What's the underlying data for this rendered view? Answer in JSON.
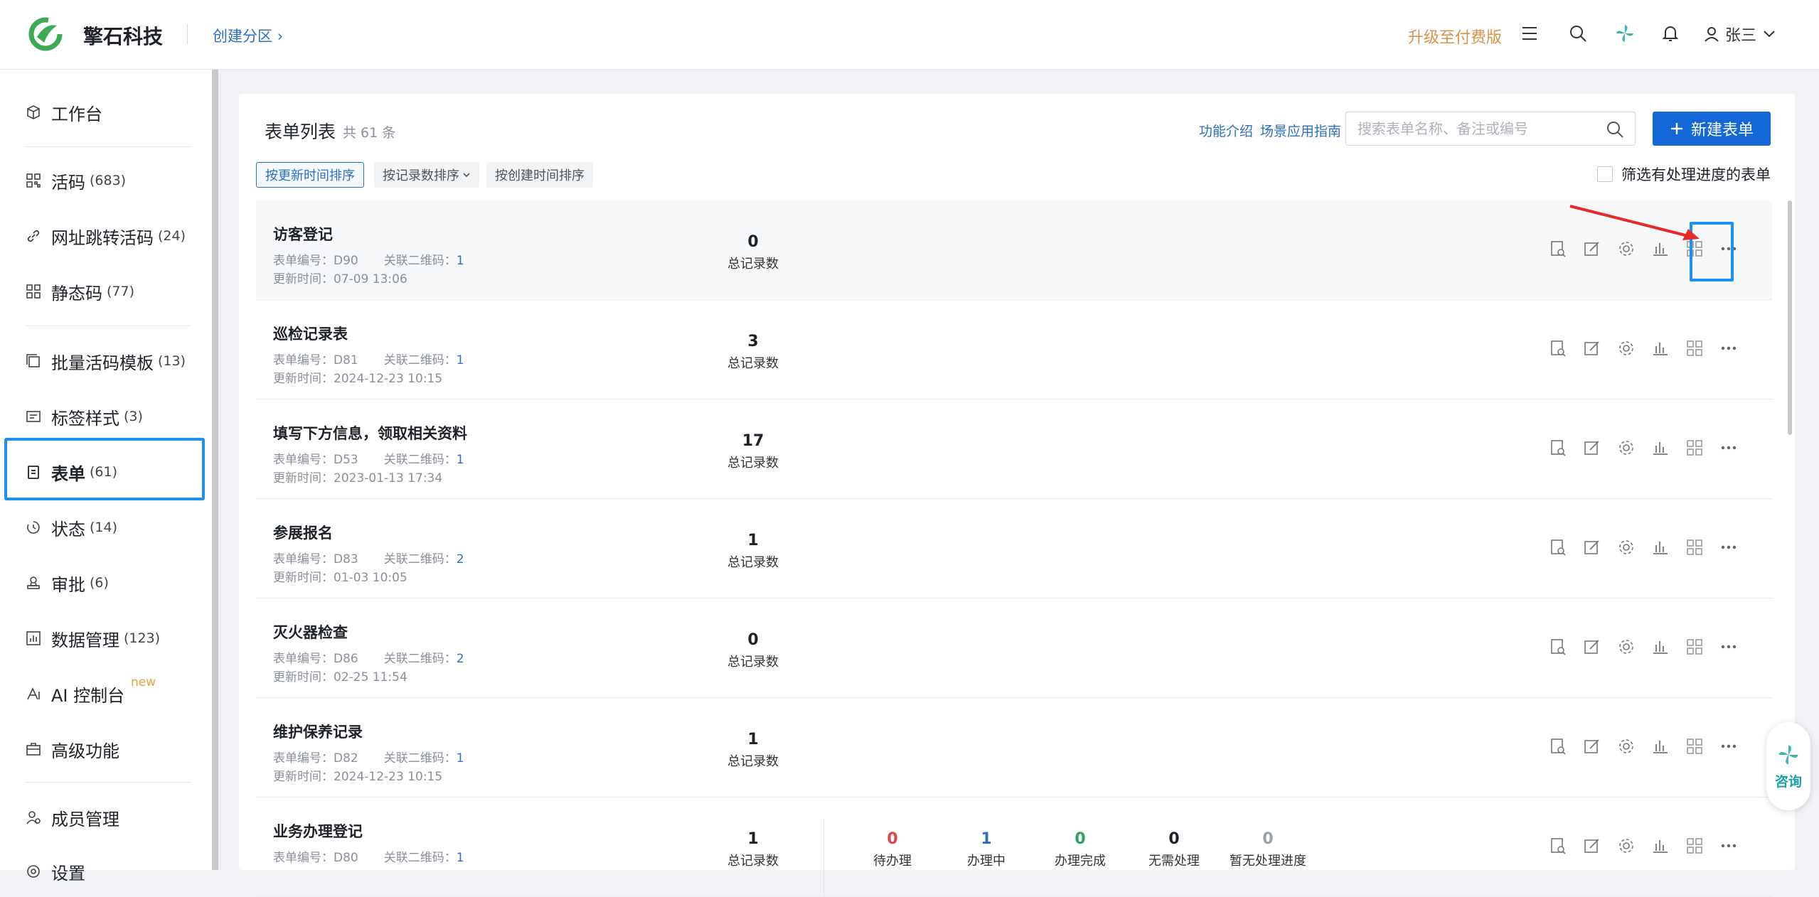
{
  "header": {
    "brand": "擎石科技",
    "breadcrumb": "创建分区",
    "upgrade": "升级至付费版",
    "user_name": "张三"
  },
  "sidebar": {
    "items": [
      {
        "label": "工作台",
        "count": "",
        "icon": "cube-icon"
      },
      {
        "label": "活码",
        "count": "(683)",
        "icon": "qrcode-icon"
      },
      {
        "label": "网址跳转活码",
        "count": "(24)",
        "icon": "link-icon"
      },
      {
        "label": "静态码",
        "count": "(77)",
        "icon": "qrcode-icon"
      },
      {
        "label": "批量活码模板",
        "count": "(13)",
        "icon": "stack-icon"
      },
      {
        "label": "标签样式",
        "count": "(3)",
        "icon": "label-icon"
      },
      {
        "label": "表单",
        "count": "(61)",
        "icon": "clipboard-icon"
      },
      {
        "label": "状态",
        "count": "(14)",
        "icon": "status-icon"
      },
      {
        "label": "审批",
        "count": "(6)",
        "icon": "stamp-icon"
      },
      {
        "label": "数据管理",
        "count": "(123)",
        "icon": "chart-icon"
      },
      {
        "label": "AI 控制台",
        "count": "",
        "icon": "ai-icon"
      },
      {
        "label": "高级功能",
        "count": "",
        "icon": "briefcase-icon"
      },
      {
        "label": "成员管理",
        "count": "",
        "icon": "member-icon"
      },
      {
        "label": "设置",
        "count": "",
        "icon": "settings-icon"
      }
    ],
    "new_tag": "new"
  },
  "main": {
    "title": "表单列表",
    "total": "共 61 条",
    "link_intro": "功能介绍",
    "link_guide": "场景应用指南",
    "search_placeholder": "搜索表单名称、备注或编号",
    "new_button": "新建表单",
    "sort": [
      "按更新时间排序",
      "按记录数排序",
      "按创建时间排序"
    ],
    "filter_label": "筛选有处理进度的表单",
    "labels": {
      "code": "表单编号：",
      "qr": "关联二维码：",
      "updated": "更新时间：",
      "total_records": "总记录数"
    },
    "rows": [
      {
        "name": "访客登记",
        "code": "D90",
        "qr": "1",
        "updated": "07-09 13:06",
        "records": "0"
      },
      {
        "name": "巡检记录表",
        "code": "D81",
        "qr": "1",
        "updated": "2024-12-23 10:15",
        "records": "3"
      },
      {
        "name": "填写下方信息，领取相关资料",
        "code": "D53",
        "qr": "1",
        "updated": "2023-01-13 17:34",
        "records": "17"
      },
      {
        "name": "参展报名",
        "code": "D83",
        "qr": "2",
        "updated": "01-03 10:05",
        "records": "1"
      },
      {
        "name": "灭火器检查",
        "code": "D86",
        "qr": "2",
        "updated": "02-25 11:54",
        "records": "0"
      },
      {
        "name": "维护保养记录",
        "code": "D82",
        "qr": "1",
        "updated": "2024-12-23 10:15",
        "records": "1"
      },
      {
        "name": "业务办理登记",
        "code": "D80",
        "qr": "1",
        "updated": "",
        "records": "1"
      }
    ],
    "progress": [
      {
        "label": "待办理",
        "value": "0",
        "color": "#e04343"
      },
      {
        "label": "办理中",
        "value": "1",
        "color": "#2e6fc2"
      },
      {
        "label": "办理完成",
        "value": "0",
        "color": "#2aa35a"
      },
      {
        "label": "无需处理",
        "value": "0",
        "color": "#1f2329"
      },
      {
        "label": "暂无处理进度",
        "value": "0",
        "color": "#9aa0a6"
      }
    ]
  },
  "consult": "咨询"
}
